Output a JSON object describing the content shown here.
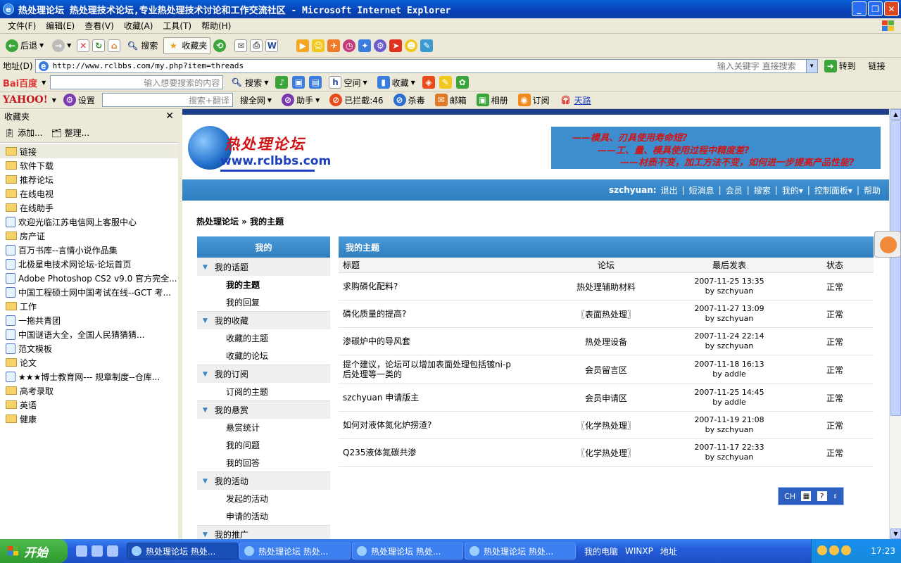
{
  "window": {
    "title": "热处理论坛 热处理技术论坛,专业热处理技术讨论和工作交流社区 - Microsoft Internet Explorer"
  },
  "menubar": [
    "文件(F)",
    "编辑(E)",
    "查看(V)",
    "收藏(A)",
    "工具(T)",
    "帮助(H)"
  ],
  "toolbar": {
    "back": "后退",
    "search": "搜索",
    "favorites": "收藏夹"
  },
  "address": {
    "label": "地址(D)",
    "url": "http://www.rclbbs.com/my.php?item=threads",
    "keyword_hint": "输入关键字 直接搜索",
    "go": "转到",
    "links": "链接"
  },
  "baidubar": {
    "brand": "Bai百度",
    "placeholder": "输入想要搜索的内容",
    "search": "搜索",
    "space": "空间",
    "collect": "收藏"
  },
  "yahoobar": {
    "brand": "YAHOO!",
    "settings": "设置",
    "placeholder": "搜索+翻译",
    "whole_web": "搜全网",
    "helper": "助手",
    "blocked": "已拦截:46",
    "antivirus": "杀毒",
    "mail": "邮箱",
    "album": "相册",
    "subscribe": "订阅",
    "tianlu": "天路"
  },
  "favorites": {
    "title": "收藏夹",
    "add": "添加...",
    "organize": "整理...",
    "items": [
      {
        "type": "folder",
        "label": "链接"
      },
      {
        "type": "folder",
        "label": "软件下载"
      },
      {
        "type": "folder",
        "label": "推荐论坛"
      },
      {
        "type": "folder",
        "label": "在线电视"
      },
      {
        "type": "folder",
        "label": "在线助手"
      },
      {
        "type": "page",
        "label": "欢迎光临江苏电信网上客服中心"
      },
      {
        "type": "folder",
        "label": "房产证"
      },
      {
        "type": "page",
        "label": "百万书库--言情小说作品集"
      },
      {
        "type": "page",
        "label": "北极星电技术网论坛-论坛首页"
      },
      {
        "type": "page",
        "label": "Adobe Photoshop CS2 v9.0 官方完全..."
      },
      {
        "type": "page",
        "label": "中国工程硕士网中国考试在线--GCT 考..."
      },
      {
        "type": "folder",
        "label": "工作"
      },
      {
        "type": "page",
        "label": "一拖共青团"
      },
      {
        "type": "page",
        "label": "中国谜语大全，全国人民猜猜猜..."
      },
      {
        "type": "page",
        "label": "范文模板"
      },
      {
        "type": "folder",
        "label": "论文"
      },
      {
        "type": "page",
        "label": "★★★博士教育网--- 规章制度--仓库..."
      },
      {
        "type": "folder",
        "label": "高考录取"
      },
      {
        "type": "folder",
        "label": "英语"
      },
      {
        "type": "folder",
        "label": "健康"
      }
    ]
  },
  "site": {
    "logo_title": "热处理论坛",
    "logo_url": "www.rclbbs.com",
    "banner": [
      "——模具、刃具使用寿命短?",
      "——工、量、模具使用过程中精度差?",
      "——材质不变，加工方法不变，如何进一步提高产品性能?"
    ],
    "nav": {
      "user": "szchyuan:",
      "links": [
        "退出",
        "短消息",
        "会员",
        "搜索",
        "我的▾",
        "控制面板▾",
        "帮助"
      ]
    },
    "breadcrumb": "热处理论坛 » 我的主题"
  },
  "leftmenu": {
    "title": "我的",
    "groups": [
      {
        "label": "我的话题",
        "subs": [
          "我的主题",
          "我的回复"
        ]
      },
      {
        "label": "我的收藏",
        "subs": [
          "收藏的主题",
          "收藏的论坛"
        ]
      },
      {
        "label": "我的订阅",
        "subs": [
          "订阅的主题"
        ]
      },
      {
        "label": "我的悬赏",
        "subs": [
          "悬赏统计",
          "我的问题",
          "我的回答"
        ]
      },
      {
        "label": "我的活动",
        "subs": [
          "发起的活动",
          "申请的活动"
        ]
      },
      {
        "label": "我的推广",
        "subs": []
      }
    ]
  },
  "threads": {
    "title": "我的主题",
    "columns": [
      "标题",
      "论坛",
      "最后发表",
      "状态"
    ],
    "rows": [
      {
        "title": "求购磷化配料?",
        "forum": "热处理辅助材料",
        "date": "2007-11-25 13:35",
        "by": "by szchyuan",
        "status": "正常"
      },
      {
        "title": "磷化质量的提高?",
        "forum": "〖表面热处理〗",
        "date": "2007-11-27 13:09",
        "by": "by szchyuan",
        "status": "正常"
      },
      {
        "title": "渗碳炉中的导风套",
        "forum": "热处理设备",
        "date": "2007-11-24 22:14",
        "by": "by szchyuan",
        "status": "正常"
      },
      {
        "title": "提个建议，论坛可以增加表面处理包括镀ni-p后处理等一类的",
        "forum": "会员留言区",
        "date": "2007-11-18 16:13",
        "by": "by addle",
        "status": "正常"
      },
      {
        "title": "szchyuan 申请版主",
        "forum": "会员申请区",
        "date": "2007-11-25 14:45",
        "by": "by addle",
        "status": "正常"
      },
      {
        "title": "如何对液体氮化炉捞渣?",
        "forum": "〖化学热处理〗",
        "date": "2007-11-19 21:08",
        "by": "by szchyuan",
        "status": "正常"
      },
      {
        "title": "Q235液体氮碳共渗",
        "forum": "〖化学热处理〗",
        "date": "2007-11-17 22:33",
        "by": "by szchyuan",
        "status": "正常"
      }
    ]
  },
  "ime": {
    "label": "CH"
  },
  "taskbar": {
    "start": "开始",
    "tasks": [
      "热处理论坛 热处...",
      "热处理论坛 热处...",
      "热处理论坛 热处...",
      "热处理论坛 热处..."
    ],
    "mycomputer": "我的电脑",
    "winxp": "WINXP",
    "address": "地址",
    "clock": "17:23"
  }
}
